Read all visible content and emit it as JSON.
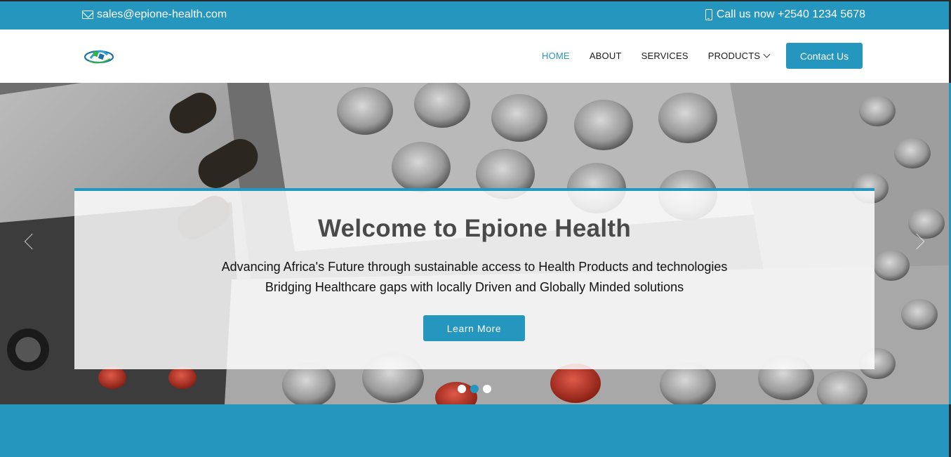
{
  "topbar": {
    "email": "sales@epione-health.com",
    "phone": "Call us now +2540 1234 5678",
    "icons": [
      "envelope-icon",
      "phone-icon"
    ]
  },
  "nav": {
    "items": [
      {
        "label": "HOME",
        "active": true
      },
      {
        "label": "ABOUT",
        "active": false
      },
      {
        "label": "SERVICES",
        "active": false
      },
      {
        "label": "PRODUCTS",
        "active": false,
        "dropdown": true
      }
    ],
    "contact_label": "Contact Us"
  },
  "hero": {
    "title": "Welcome to Epione Health",
    "line1": "Advancing Africa's Future through sustainable access to Health Products and technologies",
    "line2": "Bridging Healthcare gaps with locally Driven and Globally Minded solutions",
    "button_label": "Learn More",
    "slides": 3,
    "active_slide": 2
  },
  "colors": {
    "accent": "#2596be",
    "title_text": "#4a4a4a",
    "white": "#ffffff"
  }
}
